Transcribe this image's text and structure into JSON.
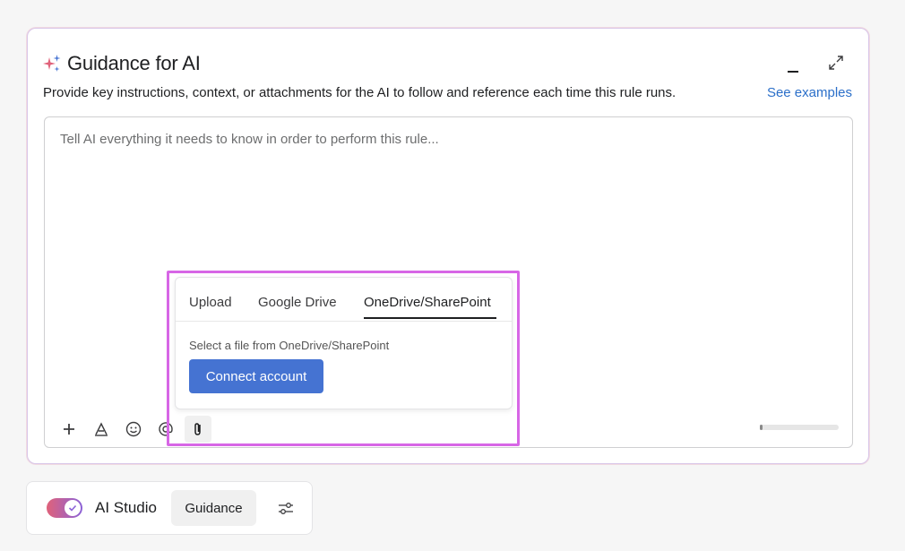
{
  "panel": {
    "title": "Guidance for AI",
    "description": "Provide key instructions, context, or attachments for the AI to follow and reference each time this rule runs.",
    "see_examples": "See examples",
    "icons": {
      "title": "sparkle-icon",
      "minimize": "minimize-icon",
      "expand": "expand-icon"
    }
  },
  "editor": {
    "placeholder": "Tell AI everything it needs to know in order to perform this rule...",
    "toolbar_icons": [
      "plus-icon",
      "format-text-icon",
      "emoji-icon",
      "mention-icon",
      "attachment-icon"
    ]
  },
  "attach_popover": {
    "tabs": [
      {
        "label": "Upload"
      },
      {
        "label": "Google Drive"
      },
      {
        "label": "OneDrive/SharePoint"
      }
    ],
    "active_tab": "OneDrive/SharePoint",
    "prompt": "Select a file from OneDrive/SharePoint",
    "connect_button": "Connect account"
  },
  "footer": {
    "toggle_on": true,
    "studio_label": "AI Studio",
    "guidance_button": "Guidance",
    "settings_icon": "sliders-icon"
  },
  "colors": {
    "accent_blue": "#4573d2",
    "link_blue": "#2b6fc9",
    "highlight": "#d766e6",
    "toggle_start": "#e0627a",
    "toggle_end": "#8b62d8"
  }
}
